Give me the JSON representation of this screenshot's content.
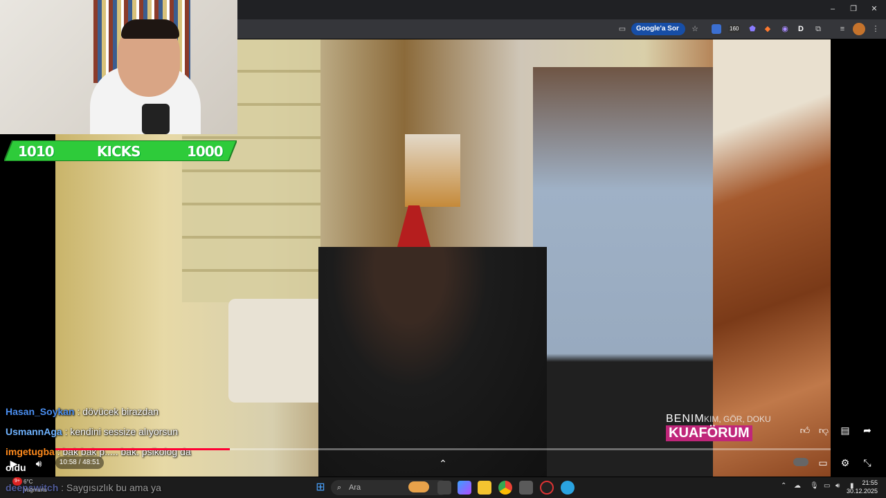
{
  "browser": {
    "ask_chip_label": "Google'a Sor",
    "badge_count": "160",
    "window_buttons": {
      "minimize": "–",
      "restore": "❐",
      "close": "✕"
    }
  },
  "stream": {
    "counter": {
      "left": "1010",
      "mid": "KICKS",
      "right": "1000"
    },
    "overlay_logo": {
      "line1": "BENIM",
      "line2": "KUAFÖRUM",
      "caption": "KIM, GÖR, DOKU"
    },
    "chat": [
      {
        "user": "Hasan_Soykan",
        "sep": " : ",
        "text": "dövücek birazdan",
        "color": "#4a8ef0"
      },
      {
        "user": "UsmannAga",
        "sep": " : ",
        "text": "kendini sessize alıyorsun",
        "color": "#6fb3ff"
      },
      {
        "user": "imgetugba",
        "sep": " : ",
        "text": "bak bak p..... bak. psikolog da",
        "color": "#ff8a1c"
      },
      {
        "user": "oldu",
        "sep": "",
        "text": "",
        "color": "#ffffff"
      },
      {
        "user": "deepswitch",
        "sep": " : ",
        "text": "Saygısızlık bu ama ya",
        "color": "#7c8fff"
      }
    ]
  },
  "player": {
    "current_time": "10:58",
    "duration": "48:51",
    "time_label": "10:58 / 48:51",
    "progress_percent": 22.5,
    "accent_color": "#ff0033"
  },
  "taskbar": {
    "weather_temp": "6°C",
    "weather_desc": "Yağmurlu",
    "notif_badge": "9+",
    "search_placeholder": "Ara",
    "clock_time": "21:55",
    "clock_date": "30.12.2025"
  },
  "icons": [
    "cast-icon",
    "star-icon",
    "extension-icon",
    "profile-icon",
    "menu-icon",
    "like-icon",
    "dislike-icon",
    "comment-icon",
    "share-icon",
    "play-icon",
    "volume-icon",
    "subtitles-icon",
    "settings-icon",
    "exit-fullscreen-icon",
    "chevron-up-icon",
    "windows-start-icon",
    "search-icon",
    "wifi-icon",
    "speaker-icon"
  ]
}
